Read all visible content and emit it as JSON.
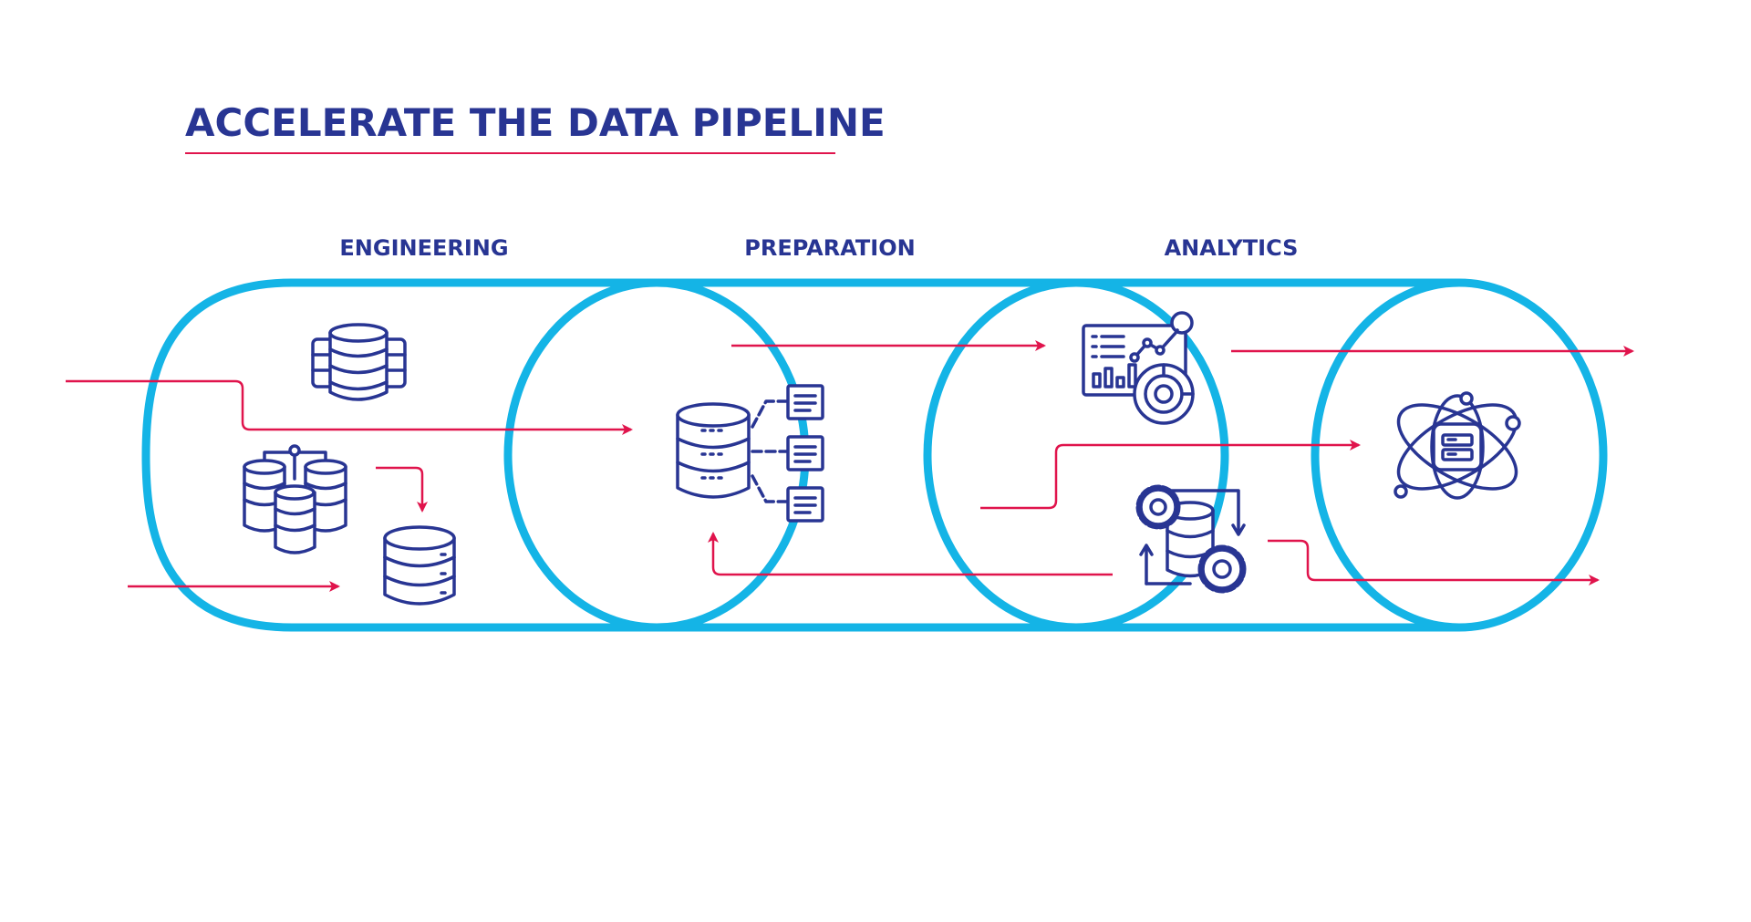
{
  "title": "ACCELERATE THE DATA PIPELINE",
  "stages": [
    {
      "label": "ENGINEERING"
    },
    {
      "label": "PREPARATION"
    },
    {
      "label": "ANALYTICS"
    }
  ],
  "colors": {
    "title": "#283593",
    "icon": "#283593",
    "arrow": "#e0144c",
    "pipe": "#14b4e6",
    "underline": "#e0144c"
  },
  "icons": [
    "server-stack-icon",
    "distributed-database-icon",
    "database-icon",
    "database-split-icon",
    "analytics-dashboard-icon",
    "database-gears-icon",
    "data-science-atom-icon"
  ]
}
